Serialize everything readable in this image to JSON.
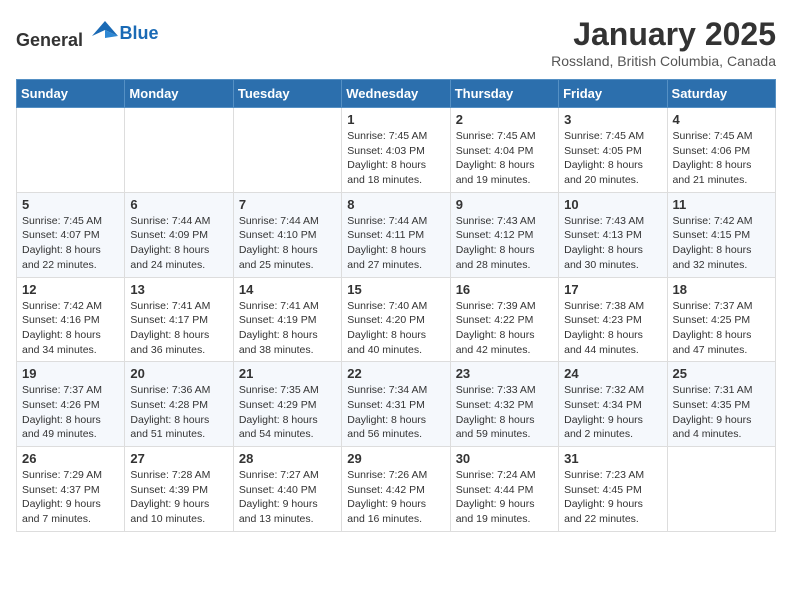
{
  "logo": {
    "general": "General",
    "blue": "Blue"
  },
  "header": {
    "title": "January 2025",
    "subtitle": "Rossland, British Columbia, Canada"
  },
  "weekdays": [
    "Sunday",
    "Monday",
    "Tuesday",
    "Wednesday",
    "Thursday",
    "Friday",
    "Saturday"
  ],
  "weeks": [
    [
      {
        "day": "",
        "info": ""
      },
      {
        "day": "",
        "info": ""
      },
      {
        "day": "",
        "info": ""
      },
      {
        "day": "1",
        "info": "Sunrise: 7:45 AM\nSunset: 4:03 PM\nDaylight: 8 hours and 18 minutes."
      },
      {
        "day": "2",
        "info": "Sunrise: 7:45 AM\nSunset: 4:04 PM\nDaylight: 8 hours and 19 minutes."
      },
      {
        "day": "3",
        "info": "Sunrise: 7:45 AM\nSunset: 4:05 PM\nDaylight: 8 hours and 20 minutes."
      },
      {
        "day": "4",
        "info": "Sunrise: 7:45 AM\nSunset: 4:06 PM\nDaylight: 8 hours and 21 minutes."
      }
    ],
    [
      {
        "day": "5",
        "info": "Sunrise: 7:45 AM\nSunset: 4:07 PM\nDaylight: 8 hours and 22 minutes."
      },
      {
        "day": "6",
        "info": "Sunrise: 7:44 AM\nSunset: 4:09 PM\nDaylight: 8 hours and 24 minutes."
      },
      {
        "day": "7",
        "info": "Sunrise: 7:44 AM\nSunset: 4:10 PM\nDaylight: 8 hours and 25 minutes."
      },
      {
        "day": "8",
        "info": "Sunrise: 7:44 AM\nSunset: 4:11 PM\nDaylight: 8 hours and 27 minutes."
      },
      {
        "day": "9",
        "info": "Sunrise: 7:43 AM\nSunset: 4:12 PM\nDaylight: 8 hours and 28 minutes."
      },
      {
        "day": "10",
        "info": "Sunrise: 7:43 AM\nSunset: 4:13 PM\nDaylight: 8 hours and 30 minutes."
      },
      {
        "day": "11",
        "info": "Sunrise: 7:42 AM\nSunset: 4:15 PM\nDaylight: 8 hours and 32 minutes."
      }
    ],
    [
      {
        "day": "12",
        "info": "Sunrise: 7:42 AM\nSunset: 4:16 PM\nDaylight: 8 hours and 34 minutes."
      },
      {
        "day": "13",
        "info": "Sunrise: 7:41 AM\nSunset: 4:17 PM\nDaylight: 8 hours and 36 minutes."
      },
      {
        "day": "14",
        "info": "Sunrise: 7:41 AM\nSunset: 4:19 PM\nDaylight: 8 hours and 38 minutes."
      },
      {
        "day": "15",
        "info": "Sunrise: 7:40 AM\nSunset: 4:20 PM\nDaylight: 8 hours and 40 minutes."
      },
      {
        "day": "16",
        "info": "Sunrise: 7:39 AM\nSunset: 4:22 PM\nDaylight: 8 hours and 42 minutes."
      },
      {
        "day": "17",
        "info": "Sunrise: 7:38 AM\nSunset: 4:23 PM\nDaylight: 8 hours and 44 minutes."
      },
      {
        "day": "18",
        "info": "Sunrise: 7:37 AM\nSunset: 4:25 PM\nDaylight: 8 hours and 47 minutes."
      }
    ],
    [
      {
        "day": "19",
        "info": "Sunrise: 7:37 AM\nSunset: 4:26 PM\nDaylight: 8 hours and 49 minutes."
      },
      {
        "day": "20",
        "info": "Sunrise: 7:36 AM\nSunset: 4:28 PM\nDaylight: 8 hours and 51 minutes."
      },
      {
        "day": "21",
        "info": "Sunrise: 7:35 AM\nSunset: 4:29 PM\nDaylight: 8 hours and 54 minutes."
      },
      {
        "day": "22",
        "info": "Sunrise: 7:34 AM\nSunset: 4:31 PM\nDaylight: 8 hours and 56 minutes."
      },
      {
        "day": "23",
        "info": "Sunrise: 7:33 AM\nSunset: 4:32 PM\nDaylight: 8 hours and 59 minutes."
      },
      {
        "day": "24",
        "info": "Sunrise: 7:32 AM\nSunset: 4:34 PM\nDaylight: 9 hours and 2 minutes."
      },
      {
        "day": "25",
        "info": "Sunrise: 7:31 AM\nSunset: 4:35 PM\nDaylight: 9 hours and 4 minutes."
      }
    ],
    [
      {
        "day": "26",
        "info": "Sunrise: 7:29 AM\nSunset: 4:37 PM\nDaylight: 9 hours and 7 minutes."
      },
      {
        "day": "27",
        "info": "Sunrise: 7:28 AM\nSunset: 4:39 PM\nDaylight: 9 hours and 10 minutes."
      },
      {
        "day": "28",
        "info": "Sunrise: 7:27 AM\nSunset: 4:40 PM\nDaylight: 9 hours and 13 minutes."
      },
      {
        "day": "29",
        "info": "Sunrise: 7:26 AM\nSunset: 4:42 PM\nDaylight: 9 hours and 16 minutes."
      },
      {
        "day": "30",
        "info": "Sunrise: 7:24 AM\nSunset: 4:44 PM\nDaylight: 9 hours and 19 minutes."
      },
      {
        "day": "31",
        "info": "Sunrise: 7:23 AM\nSunset: 4:45 PM\nDaylight: 9 hours and 22 minutes."
      },
      {
        "day": "",
        "info": ""
      }
    ]
  ]
}
